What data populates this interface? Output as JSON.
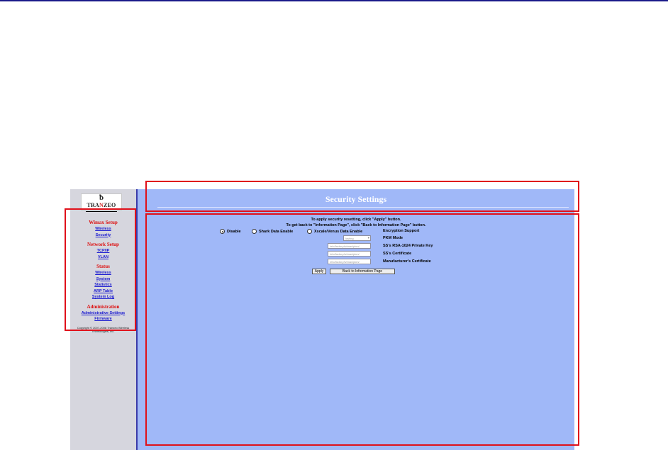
{
  "brand": {
    "logo_text_left": "TRA",
    "logo_text_mid": "N",
    "logo_text_right": "ZEO"
  },
  "sidebar": {
    "groups": [
      {
        "title": "Wimax Setup",
        "links": [
          "Wireless",
          "Security"
        ]
      },
      {
        "title": "Network Setup",
        "links": [
          "TCP/IP",
          "VLAN"
        ]
      },
      {
        "title": "Status",
        "links": [
          "Wireless",
          "System",
          "Statistics",
          "ARP Table",
          "System Log"
        ]
      },
      {
        "title": "Administration",
        "links": [
          "Administrative Settings",
          "Firmware"
        ]
      }
    ],
    "copyright": "Copyright © 2007-2008 Tranzeo Wireless Technologies, Inc."
  },
  "header": {
    "title": "Security Settings"
  },
  "main": {
    "instruction_1": "To apply security resetting, click \"Apply\" button.",
    "instruction_2": "To get back to \"Information Page\", click \"Back to Information Page\" button.",
    "encryption": {
      "label": "Encryption Support",
      "options": [
        {
          "label": "Disable",
          "selected": true
        },
        {
          "label": "Shark Data Enable",
          "selected": false
        },
        {
          "label": "Xscale/Venus Data Enable",
          "selected": false
        }
      ]
    },
    "pkm_mode": {
      "label": "PKM Mode",
      "value": "lasting"
    },
    "private_key": {
      "label": "SS's RSA-1024 Private Key",
      "value": "/etc/factory/wimax/pkm/"
    },
    "ss_cert": {
      "label": "SS's Certificate",
      "value": "/etc/factory/wimax/pkm/"
    },
    "mfr_cert": {
      "label": "Manufacturer's Certificate",
      "value": "/etc/factory/wimax/pkm/"
    },
    "apply_label": "Apply",
    "back_label": "Back to Information Page"
  },
  "colors": {
    "highlight": "#e0101a",
    "panel": "#a0b8f8",
    "sidebar": "#d6d6de",
    "nav_header": "#dd1111",
    "nav_link": "#1a1ad0"
  }
}
